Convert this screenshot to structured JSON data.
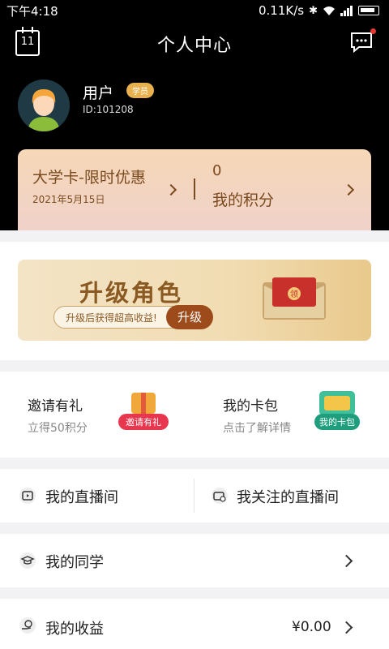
{
  "status_bar": {
    "time": "下午4:18",
    "network_speed": "0.11K/s"
  },
  "header": {
    "title": "个人中心",
    "calendar_day": "11"
  },
  "user": {
    "name": "用户",
    "role_badge": "学员",
    "id": "ID:101208"
  },
  "vip_card": {
    "title": "大学卡-限时优惠",
    "date": "2021年5月15日",
    "points_value": "0",
    "points_label": "我的积分"
  },
  "banner": {
    "title": "升级角色",
    "subtitle": "升级后获得超高收益!",
    "button": "升级",
    "envelope_badge": "领"
  },
  "promos": [
    {
      "title": "邀请有礼",
      "subtitle": "立得50积分",
      "badge": "邀请有礼"
    },
    {
      "title": "我的卡包",
      "subtitle": "点击了解详情",
      "badge": "我的卡包"
    }
  ],
  "live": {
    "my_live": "我的直播间",
    "followed_live": "我关注的直播间"
  },
  "menu": {
    "classmates": "我的同学",
    "earnings": "我的收益",
    "earnings_value": "¥0.00"
  },
  "colors": {
    "gold": "#e8b14e",
    "brown": "#7a4a1e",
    "upgrade": "#9e4b1c"
  }
}
